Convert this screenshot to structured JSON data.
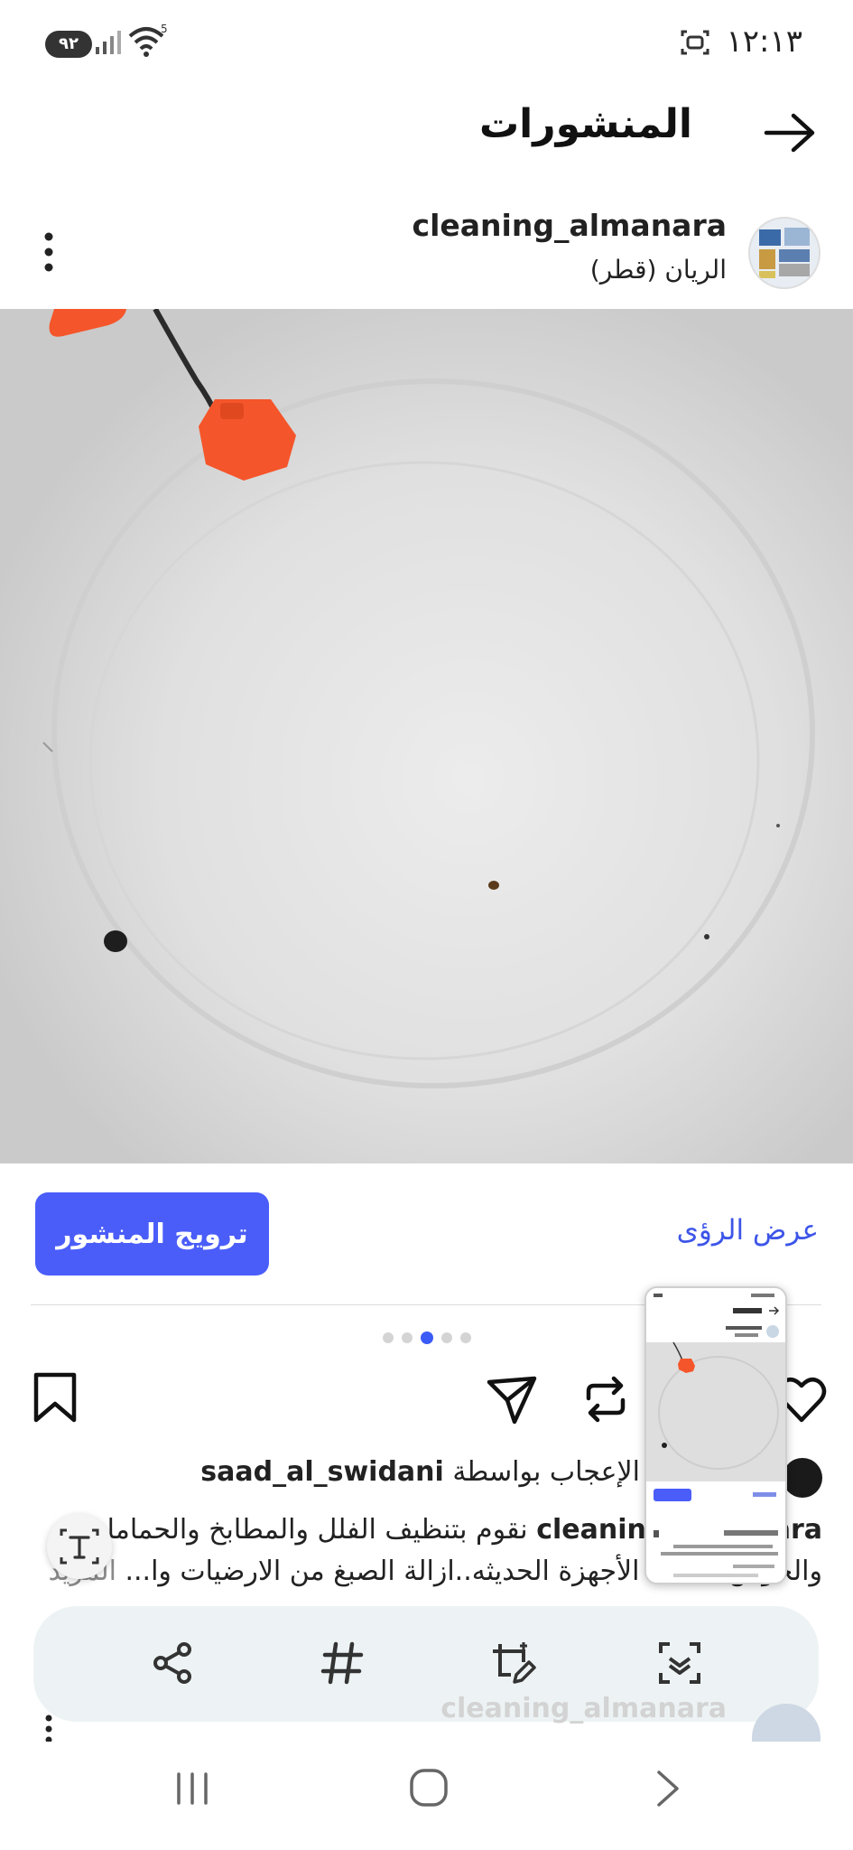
{
  "status_bar": {
    "time": "١٢:١٣",
    "battery": "٩٢",
    "wifi_badge": "5"
  },
  "header": {
    "title": "المنشورات"
  },
  "post": {
    "username": "cleaning_almanara",
    "location": "الريان (قطر)",
    "promote_label": "ترويج المنشور",
    "insights_label": "عرض الرؤى",
    "carousel": {
      "count": 5,
      "active_index": 2
    },
    "likes": {
      "prefix": "الإعجاب بواسطة ",
      "user": "saad_al_swidani"
    },
    "caption": {
      "author": "cleaning_almanara",
      "line1_text": " نقوم بتنظيف الفلل والمطابخ والحمامات",
      "line2_text": "والحوش بأحدث الأجهزة الحديثه..ازالة الصبغ من الارضيات وا... ",
      "more": "المزيد"
    }
  },
  "next_post": {
    "username": "cleaning_almanara"
  },
  "icons": {
    "back": "arrow-right-icon",
    "more": "more-vertical-icon",
    "heart": "heart-icon",
    "repost": "repost-icon",
    "send": "send-icon",
    "bookmark": "bookmark-icon",
    "text_extract": "text-extract-icon",
    "share": "share-icon",
    "hashtag": "hashtag-icon",
    "crop_edit": "crop-edit-icon",
    "scan": "scan-icon"
  },
  "colors": {
    "accent": "#4a5df9",
    "link": "#3d55e8",
    "active_dot": "#3b5bf6"
  }
}
